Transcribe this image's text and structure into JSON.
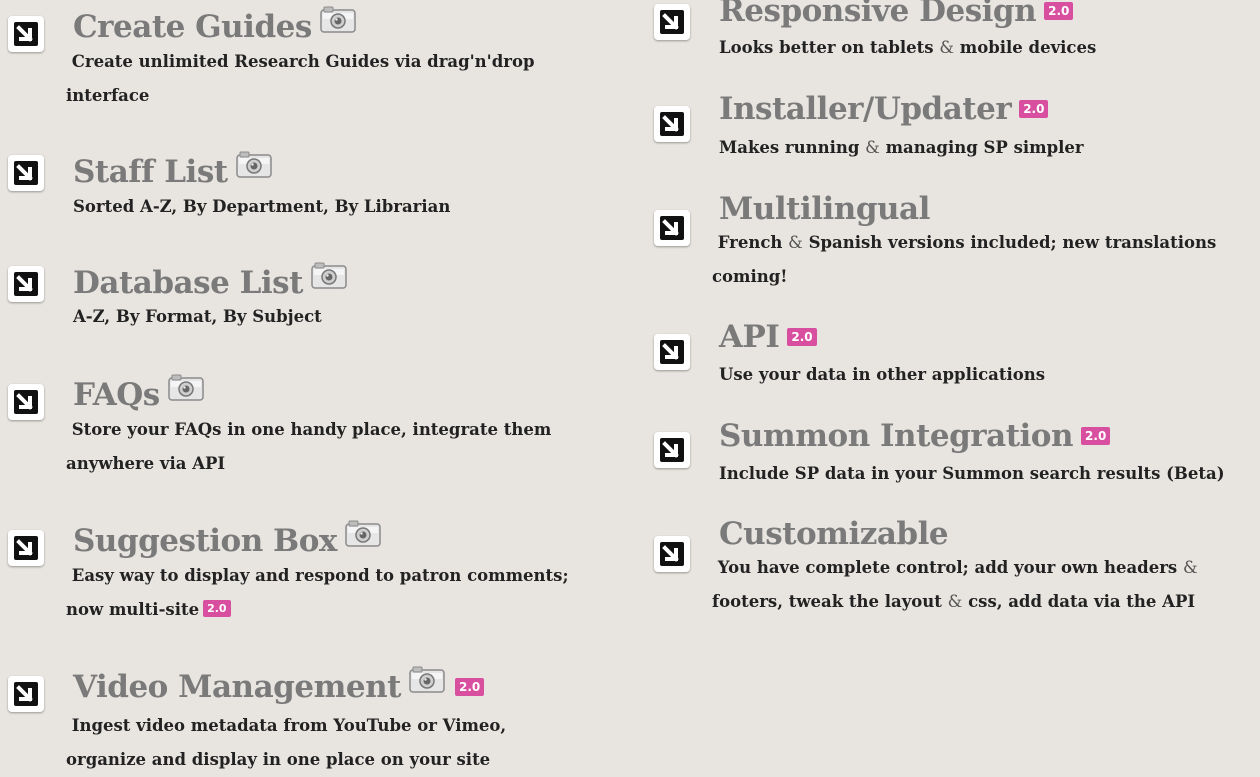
{
  "badge": "2.0",
  "left": {
    "create_guides": {
      "title": "Create Guides",
      "desc_line1": "Create unlimited Research Guides via drag'n'drop",
      "desc_line2": "interface"
    },
    "staff_list": {
      "title": "Staff List",
      "desc_line1": "Sorted A-Z, By Department, By Librarian"
    },
    "database_list": {
      "title": "Database List",
      "desc_line1": "A-Z, By Format, By Subject"
    },
    "faqs": {
      "title": "FAQs",
      "desc_line1": "Store your FAQs in one handy place, integrate them",
      "desc_line2": "anywhere via API"
    },
    "suggestion_box": {
      "title": "Suggestion Box",
      "desc_line1": "Easy way to display and respond to patron comments;",
      "desc_line2": "now multi-site"
    },
    "video_management": {
      "title": "Video Management",
      "desc_line1": "Ingest video metadata from YouTube or Vimeo,",
      "desc_line2": "organize and display in one place on your site"
    }
  },
  "right": {
    "responsive_design": {
      "title": "Responsive Design",
      "desc_a": "Looks better on tablets",
      "desc_amp": "&",
      "desc_b": "mobile devices"
    },
    "installer_updater": {
      "title": "Installer/Updater",
      "desc_a": "Makes running",
      "desc_amp": "&",
      "desc_b": "managing SP simpler"
    },
    "multilingual": {
      "title": "Multilingual",
      "desc_a": "French",
      "desc_amp": "&",
      "desc_b": "Spanish versions included; new translations",
      "desc_line2": "coming!"
    },
    "api": {
      "title": "API",
      "desc_line1": "Use your data in other applications"
    },
    "summon_integration": {
      "title": "Summon Integration",
      "desc_line1": "Include SP data in your Summon search results (Beta)"
    },
    "customizable": {
      "title": "Customizable",
      "desc_a": "You have complete control; add your own headers",
      "desc_amp": "&",
      "desc_line2_a": "footers, tweak the layout",
      "desc_line2_amp": "&",
      "desc_line2_b": "css, add data via the API"
    }
  }
}
